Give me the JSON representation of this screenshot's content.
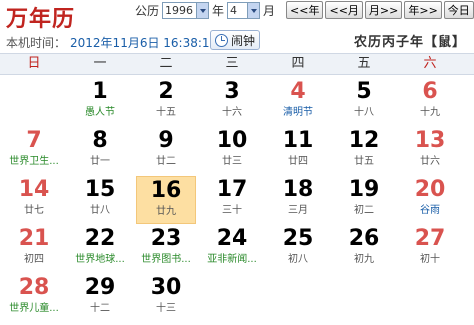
{
  "app_title": "万年历",
  "controls": {
    "gregorian_label": "公历",
    "year_value": "1996",
    "year_label": "年",
    "month_value": "4",
    "month_label": "月",
    "prev_year": "<<年",
    "prev_month": "<<月",
    "next_month": "月>>",
    "next_year": "年>>",
    "today": "今日"
  },
  "local_time": {
    "label": "本机时间：",
    "value": "2012年11月6日 16:38:11"
  },
  "alarm_label": "闹钟",
  "lunar_year": "农历丙子年【鼠】",
  "weekdays": [
    "日",
    "一",
    "二",
    "三",
    "四",
    "五",
    "六"
  ],
  "days": [
    {
      "n": "",
      "s": ""
    },
    {
      "n": "1",
      "s": "愚人节",
      "sc": "green"
    },
    {
      "n": "2",
      "s": "十五"
    },
    {
      "n": "3",
      "s": "十六"
    },
    {
      "n": "4",
      "s": "清明节",
      "sc": "blue",
      "red": true
    },
    {
      "n": "5",
      "s": "十八"
    },
    {
      "n": "6",
      "s": "十九",
      "red": true
    },
    {
      "n": "7",
      "s": "世界卫生...",
      "sc": "green",
      "red": true
    },
    {
      "n": "8",
      "s": "廿一"
    },
    {
      "n": "9",
      "s": "廿二"
    },
    {
      "n": "10",
      "s": "廿三"
    },
    {
      "n": "11",
      "s": "廿四"
    },
    {
      "n": "12",
      "s": "廿五"
    },
    {
      "n": "13",
      "s": "廿六",
      "red": true
    },
    {
      "n": "14",
      "s": "廿七",
      "red": true
    },
    {
      "n": "15",
      "s": "廿八"
    },
    {
      "n": "16",
      "s": "廿九",
      "selected": true
    },
    {
      "n": "17",
      "s": "三十"
    },
    {
      "n": "18",
      "s": "三月"
    },
    {
      "n": "19",
      "s": "初二"
    },
    {
      "n": "20",
      "s": "谷雨",
      "sc": "blue",
      "red": true
    },
    {
      "n": "21",
      "s": "初四",
      "red": true
    },
    {
      "n": "22",
      "s": "世界地球...",
      "sc": "green"
    },
    {
      "n": "23",
      "s": "世界图书...",
      "sc": "green"
    },
    {
      "n": "24",
      "s": "亚非新闻...",
      "sc": "green"
    },
    {
      "n": "25",
      "s": "初八"
    },
    {
      "n": "26",
      "s": "初九"
    },
    {
      "n": "27",
      "s": "初十",
      "red": true
    },
    {
      "n": "28",
      "s": "世界儿童...",
      "sc": "green",
      "red": true
    },
    {
      "n": "29",
      "s": "十二"
    },
    {
      "n": "30",
      "s": "十三"
    }
  ]
}
